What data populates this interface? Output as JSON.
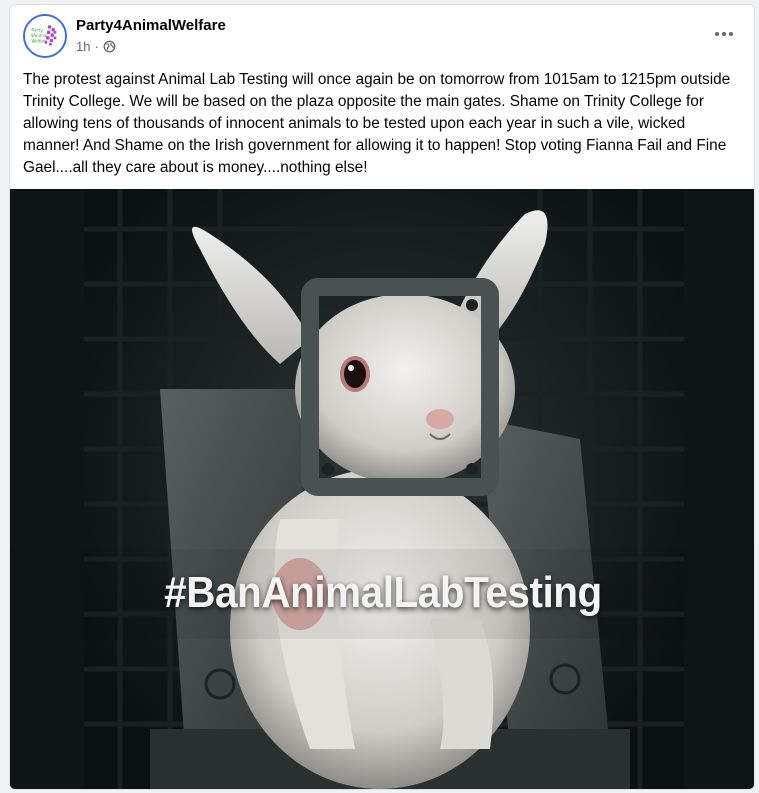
{
  "post": {
    "page_name": "Party4AnimalWelfare",
    "time_ago": "1h",
    "separator": "·",
    "audience_icon": "globe-icon",
    "more_icon": "more-options-icon",
    "text": "The protest against Animal Lab Testing will once again be on tomorrow from 1015am to 1215pm outside Trinity College. We will be based on the plaza opposite the main gates. Shame on Trinity College for allowing tens of thousands of innocent animals to be tested upon each year in such a vile, wicked manner! And Shame on the Irish government for allowing it to happen! Stop voting Fianna Fail and Fine Gael....all they care about is money....nothing else!",
    "avatar_lines": [
      "Party",
      "4Animal",
      "Welfare"
    ]
  },
  "image": {
    "overlay_text": "#BanAnimalLabTesting"
  },
  "colors": {
    "card_bg": "#ffffff",
    "page_bg": "#f0f2f5",
    "text_primary": "#050505",
    "text_secondary": "#65676b",
    "avatar_ring": "#3b6fd6",
    "avatar_accent": "#b844c8"
  }
}
